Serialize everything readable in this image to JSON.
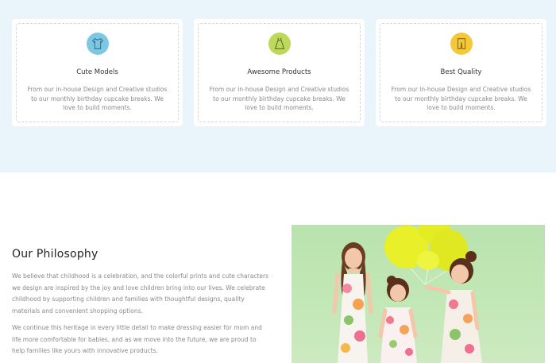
{
  "features": [
    {
      "title": "Cute Models",
      "text": "From our in-house Design and Creative studios to our monthly birthday cupcake breaks. We love to build moments.",
      "icon": "shirt-icon",
      "icon_color": "#7cc7e3"
    },
    {
      "title": "Awesome Products",
      "text": "From our in-house Design and Creative studios to our monthly birthday cupcake breaks. We love to build moments.",
      "icon": "dress-icon",
      "icon_color": "#bdd85a"
    },
    {
      "title": "Best Quality",
      "text": "From our in-house Design and Creative studios to our monthly birthday cupcake breaks. We love to build moments.",
      "icon": "pants-icon",
      "icon_color": "#f5c83a"
    }
  ],
  "philosophy": {
    "title": "Our Philosophy",
    "paragraph1": "We believe that childhood is a celebration, and the colorful prints and cute characters we design are inspired by the joy and love children bring into our lives. We celebrate childhood by supporting children and families with thoughtful designs, quality materials and convenient shopping options.",
    "paragraph2": "We continue this heritage in every little detail to make dressing easier for mom and life more comfortable for babies, and as we move into the future, we are proud to help families like yours with innovative products."
  },
  "photo": {
    "subject": "three-girls-with-yellow-balloons",
    "background_color": "#c1e6b5",
    "balloon_color": "#e8ef2a"
  }
}
